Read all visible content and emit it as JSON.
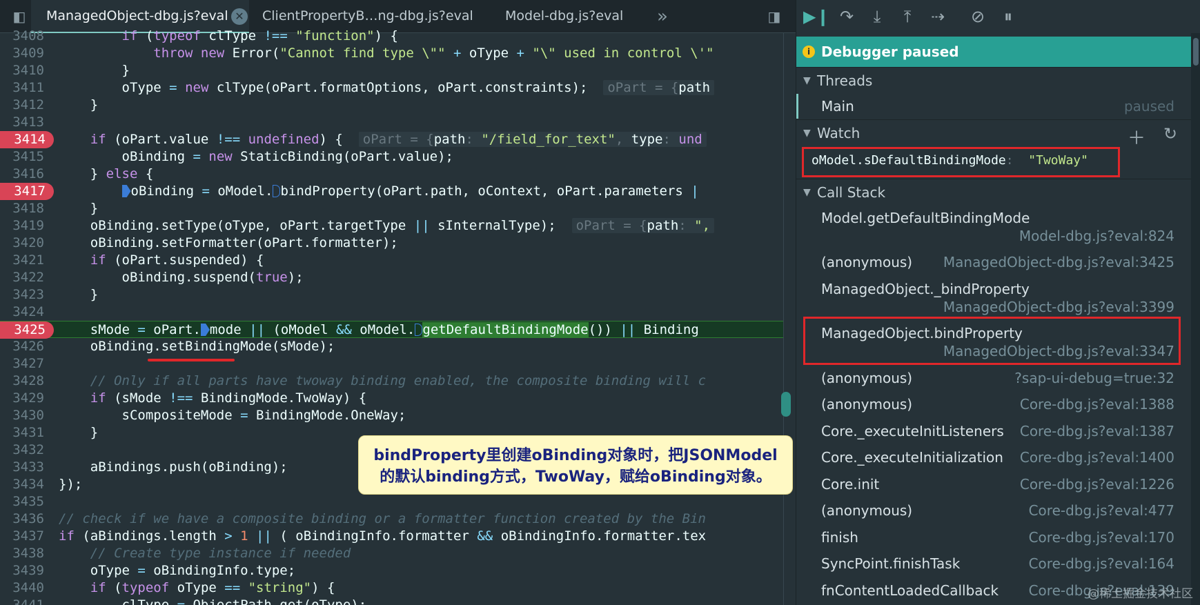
{
  "tabs": [
    {
      "label": "ManagedObject-dbg.js?eval",
      "active": true
    },
    {
      "label": "ClientPropertyB…ng-dbg.js?eval",
      "active": false
    },
    {
      "label": "Model-dbg.js?eval",
      "active": false
    }
  ],
  "tabbar": {
    "more_label": "»"
  },
  "code": {
    "breakpoint_lines": [
      "3414",
      "3417",
      "3425"
    ],
    "current_line": "3425"
  },
  "annotation": {
    "line1": "bindProperty里创建oBinding对象时，把JSONModel",
    "line2": "的默认binding方式，TwoWay，赋给oBinding对象。"
  },
  "debugger": {
    "status": "Debugger paused",
    "threads": {
      "title": "Threads",
      "items": [
        {
          "name": "Main",
          "state": "paused"
        }
      ]
    },
    "watch": {
      "title": "Watch",
      "expressions": [
        {
          "expr": "oModel.sDefaultBindingMode",
          "value": "\"TwoWay\""
        }
      ]
    },
    "call_stack": {
      "title": "Call Stack",
      "frames": [
        {
          "name": "Model.getDefaultBindingMode",
          "location": "Model-dbg.js?eval:824"
        },
        {
          "name": "(anonymous)",
          "location": "ManagedObject-dbg.js?eval:3425"
        },
        {
          "name": "ManagedObject._bindProperty",
          "location": "ManagedObject-dbg.js?eval:3399"
        },
        {
          "name": "ManagedObject.bindProperty",
          "location": "ManagedObject-dbg.js?eval:3347"
        },
        {
          "name": "(anonymous)",
          "location": "?sap-ui-debug=true:32"
        },
        {
          "name": "(anonymous)",
          "location": "Core-dbg.js?eval:1388"
        },
        {
          "name": "Core._executeInitListeners",
          "location": "Core-dbg.js?eval:1387"
        },
        {
          "name": "Core._executeInitialization",
          "location": "Core-dbg.js?eval:1400"
        },
        {
          "name": "Core.init",
          "location": "Core-dbg.js?eval:1226"
        },
        {
          "name": "(anonymous)",
          "location": "Core-dbg.js?eval:477"
        },
        {
          "name": "finish",
          "location": "Core-dbg.js?eval:170"
        },
        {
          "name": "SyncPoint.finishTask",
          "location": "Core-dbg.js?eval:164"
        },
        {
          "name": "fnContentLoadedCallback",
          "location": "Core-dbg.js?eval:139"
        }
      ]
    }
  },
  "watermark": "@稀土掘金技术社区",
  "colors": {
    "background": "#263238",
    "accent": "#28a094",
    "breakpoint": "#d94456",
    "annotation_box": "#e0272a"
  }
}
